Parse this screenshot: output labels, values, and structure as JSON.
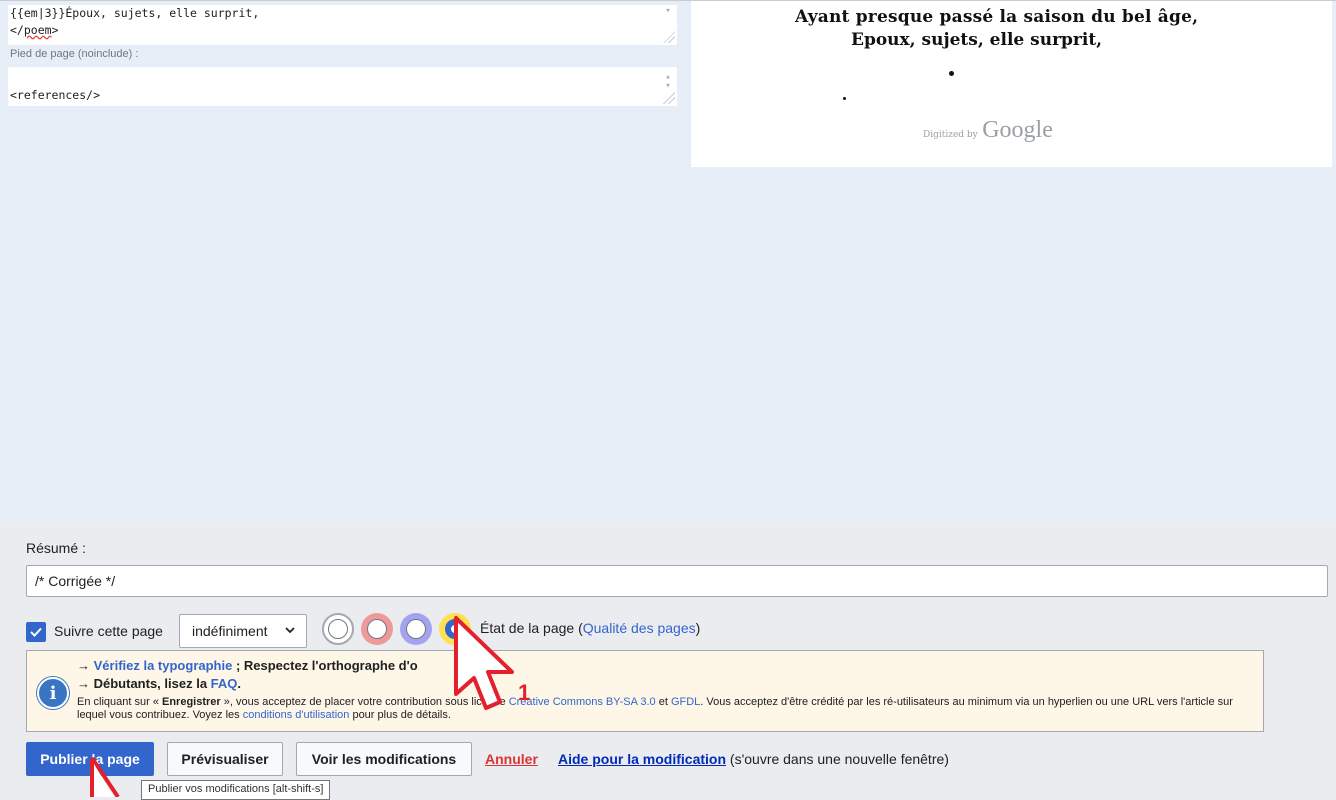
{
  "editor": {
    "body_lines": [
      "{{em|3}}Époux, sujets, elle surprit,",
      "</",
      "poem",
      ">"
    ],
    "footer_label": "Pied de page (noinclude) :",
    "footer_text": "<references/>"
  },
  "scan": {
    "line1": "Ayant presque passé la saison du bel âge,",
    "line2": "Epoux, sujets, elle surprit,",
    "watermark_small": "Digitized by",
    "watermark_big": "Google"
  },
  "summary": {
    "label": "Résumé :",
    "value": "/* Corrigée */"
  },
  "watch": {
    "label": "Suivre cette page",
    "checked": true,
    "expiry": "indéfiniment"
  },
  "quality": {
    "options": [
      {
        "name": "quality-0",
        "color": "#a2a9b1"
      },
      {
        "name": "quality-1",
        "color": "#ef9a9a"
      },
      {
        "name": "quality-3",
        "color": "#a3a4f0"
      },
      {
        "name": "quality-4",
        "color": "#ffe14d"
      }
    ],
    "selected_index": 3,
    "label_prefix": "État de la page (",
    "label_link": "Qualité des pages",
    "label_suffix": ")"
  },
  "notice": {
    "arrow": "→",
    "verify_link": "Vérifiez la typographie",
    "verify_rest": " ; Respectez l'orthographe d'o",
    "beginners": "Débutants, lisez la ",
    "faq": "FAQ",
    "faq_dot": ".",
    "legal_1": "En cliquant sur « ",
    "legal_bold": "Enregistrer",
    "legal_2": " », vous acceptez de placer votre contribution sous licence ",
    "cc_link": "Creative Commons BY-SA 3.0",
    "legal_3": " et ",
    "gfdl_link": "GFDL",
    "legal_4": ". Vous acceptez d'être crédité par les ré-utilisateurs au minimum via un hyperlien ou une URL vers l'article sur lequel vous contribuez. Voyez les ",
    "terms_link": "conditions d'utilisation",
    "legal_5": " pour plus de détails."
  },
  "actions": {
    "publish": "Publier la page",
    "preview": "Prévisualiser",
    "diff": "Voir les modifications",
    "cancel": "Annuler",
    "help_link": "Aide pour la modification",
    "help_suffix": " (s'ouvre dans une nouvelle fenêtre)",
    "tooltip": "Publier vos modifications [alt-shift-s]"
  },
  "annotation": {
    "step_number": "1"
  }
}
